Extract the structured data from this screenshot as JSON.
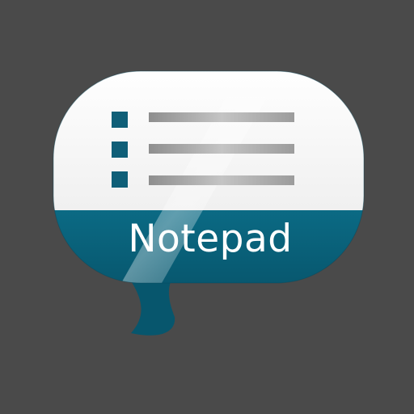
{
  "app": {
    "name": "Notepad",
    "icon": "speech-bubble-list-icon"
  },
  "list": {
    "item_count": 3
  },
  "colors": {
    "background": "#4a4a4a",
    "bubble_top": "#ffffff",
    "bubble_band": "#08637c",
    "bullet": "#0f5f78",
    "line": "#9a9a9a",
    "text": "#ffffff"
  }
}
